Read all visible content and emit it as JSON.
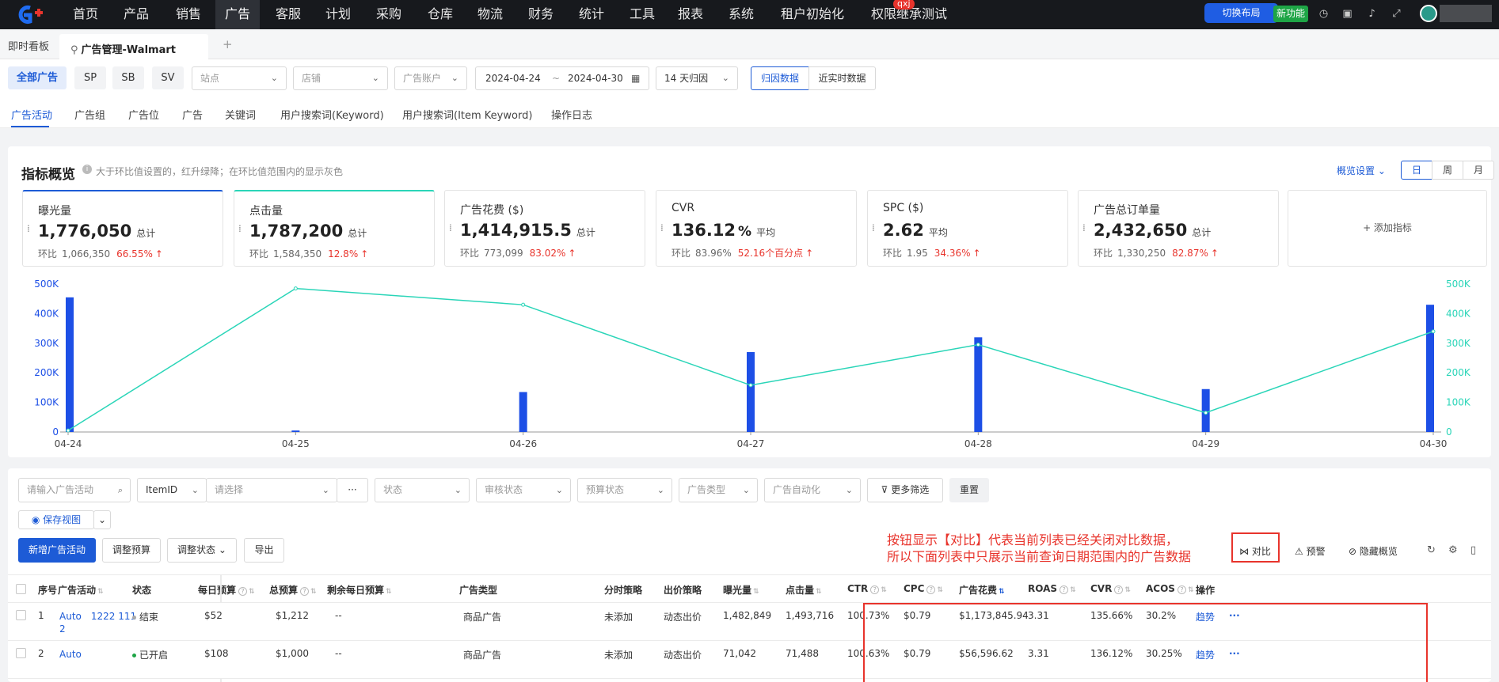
{
  "topnav": {
    "items": [
      "首页",
      "产品",
      "销售",
      "广告",
      "客服",
      "计划",
      "采购",
      "仓库",
      "物流",
      "财务",
      "统计",
      "工具",
      "报表",
      "系统",
      "租户初始化",
      "权限继承测试"
    ],
    "active": "广告",
    "badge": "qxj",
    "switch_layout": "切换布局",
    "new_feature": "新功能",
    "icons": [
      "clock-icon",
      "calendar-check-icon",
      "bell-icon",
      "expand-icon"
    ],
    "colors": {
      "bg": "#17191d",
      "accent": "#1f5de3",
      "new": "#1ea546"
    }
  },
  "tabs": {
    "dashboard": "即时看板",
    "current": "广告管理-Walmart",
    "add": "+"
  },
  "filters": {
    "ad_types": [
      "全部广告",
      "SP",
      "SB",
      "SV"
    ],
    "site_placeholder": "站点",
    "store_placeholder": "店铺",
    "account_placeholder": "广告账户",
    "date_start": "2024-04-24",
    "date_sep": "~",
    "date_end": "2024-04-30",
    "attribution": "14 天归因",
    "data_modes": [
      "归因数据",
      "近实时数据"
    ]
  },
  "subtabs": [
    "广告活动",
    "广告组",
    "广告位",
    "广告",
    "关键词",
    "用户搜索词(Keyword)",
    "用户搜索词(Item Keyword)",
    "操作日志"
  ],
  "overview": {
    "title": "指标概览",
    "hint": "大于环比值设置的，红升绿降；在环比值范围内的显示灰色",
    "settings": "概览设置",
    "periods": [
      "日",
      "周",
      "月"
    ],
    "compare_label": "环比",
    "add_metric": "+ 添加指标",
    "metrics": [
      {
        "name": "曝光量",
        "value": "1,776,050",
        "unit": "总计",
        "compare": "1,066,350",
        "pct": "66.55%"
      },
      {
        "name": "点击量",
        "value": "1,787,200",
        "unit": "总计",
        "compare": "1,584,350",
        "pct": "12.8%"
      },
      {
        "name": "广告花费 ($)",
        "value": "1,414,915.5",
        "unit": "总计",
        "compare": "773,099",
        "pct": "83.02%"
      },
      {
        "name": "CVR",
        "value": "136.12",
        "unit": "平均",
        "compare": "83.96%",
        "pct": "52.16个百分点",
        "suffix": "%"
      },
      {
        "name": "SPC ($)",
        "value": "2.62",
        "unit": "平均",
        "compare": "1.95",
        "pct": "34.36%"
      },
      {
        "name": "广告总订单量",
        "value": "2,432,650",
        "unit": "总计",
        "compare": "1,330,250",
        "pct": "82.87%"
      }
    ]
  },
  "chart_data": {
    "type": "bar",
    "categories": [
      "04-24",
      "04-25",
      "04-26",
      "04-27",
      "04-28",
      "04-29",
      "04-30"
    ],
    "series": [
      {
        "type": "bar",
        "color": "#1d4fe6",
        "values": [
          455000,
          5000,
          135000,
          270000,
          320000,
          145000,
          430000
        ]
      },
      {
        "type": "line",
        "color": "#2ad5b8",
        "values": [
          5000,
          485000,
          430000,
          158000,
          295000,
          65000,
          340000
        ]
      }
    ],
    "y_ticks": [
      "0",
      "100K",
      "200K",
      "300K",
      "400K",
      "500K"
    ],
    "ylim": [
      0,
      500000
    ],
    "grid": false
  },
  "list": {
    "search_placeholder": "请输入广告活动",
    "itemid": "ItemID",
    "item_placeholder": "请选择",
    "more": "···",
    "status": "状态",
    "review_status": "审核状态",
    "budget_status": "预算状态",
    "ad_type": "广告类型",
    "automation": "广告自动化",
    "more_filters": "更多筛选",
    "reset": "重置",
    "save_view": "保存视图",
    "new_campaign": "新增广告活动",
    "adjust_budget": "调整预算",
    "adjust_status": "调整状态",
    "export": "导出",
    "annotation": [
      "按钮显示【对比】代表当前列表已经关闭对比数据，",
      "所以下面列表中只展示当前查询日期范围内的广告数据"
    ],
    "compare": "对比",
    "alert": "预警",
    "hide_overview": "隐藏概览",
    "headers": [
      "序号",
      "广告活动",
      "状态",
      "每日预算",
      "总预算",
      "剩余每日预算",
      "广告类型",
      "分时策略",
      "出价策略",
      "曝光量",
      "点击量",
      "CTR",
      "CPC",
      "广告花费",
      "ROAS",
      "CVR",
      "ACOS",
      "操作"
    ],
    "rows": [
      {
        "no": "1",
        "campaign": "Auto　1222 111",
        "campaign2": "2",
        "status": "结束",
        "status_color": "#aaaaaa",
        "daily": "$52",
        "total": "$1,212",
        "remaining": "--",
        "type": "商品广告",
        "timing": "未添加",
        "bid": "动态出价",
        "imp": "1,482,849",
        "clicks": "1,493,716",
        "ctr": "100.73%",
        "cpc": "$0.79",
        "spend": "$1,173,845.94",
        "roas": "3.31",
        "cvr": "135.66%",
        "acos": "30.2%",
        "trend": "趋势",
        "more": "···"
      },
      {
        "no": "2",
        "campaign": "Auto",
        "campaign2": "",
        "status": "已开启",
        "status_color": "#1ea546",
        "daily": "$108",
        "total": "$1,000",
        "remaining": "--",
        "type": "商品广告",
        "timing": "未添加",
        "bid": "动态出价",
        "imp": "71,042",
        "clicks": "71,488",
        "ctr": "100.63%",
        "cpc": "$0.79",
        "spend": "$56,596.62",
        "roas": "3.31",
        "cvr": "136.12%",
        "acos": "30.25%",
        "trend": "趋势",
        "more": "···"
      }
    ]
  }
}
